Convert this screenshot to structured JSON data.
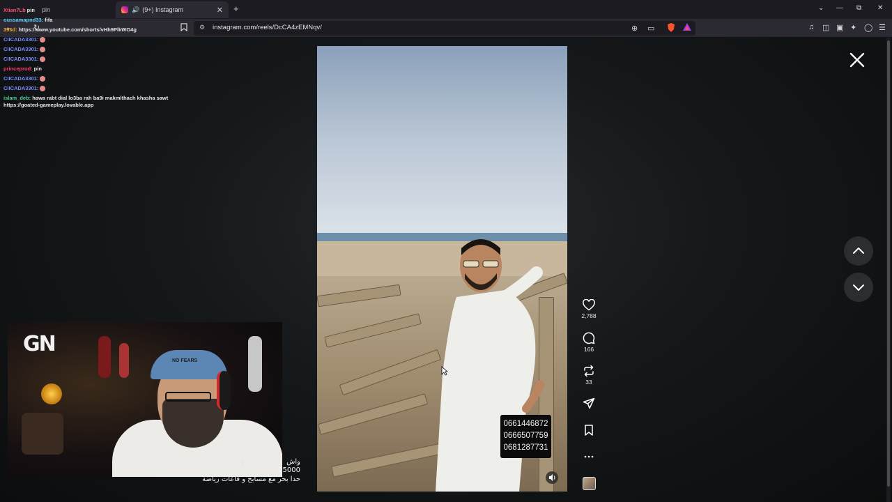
{
  "browser": {
    "tabs": [
      {
        "label": "pin",
        "active": false
      },
      {
        "label": "(9+) Instagram",
        "active": true
      }
    ],
    "url": "instagram.com/reels/DcCA4zEMNqv/",
    "icons": [
      "back-icon",
      "reload-icon",
      "bookmark-icon",
      "zoom-icon",
      "cast-icon",
      "brave-shield-icon",
      "rewards-icon",
      "music-icon",
      "sidebar-icon",
      "wallet-icon",
      "leo-ai-icon",
      "vpn-icon",
      "menu-icon"
    ]
  },
  "chat": {
    "messages": [
      {
        "user": "Xtian7Lb",
        "text": "pin",
        "color": "#ff4d6d"
      },
      {
        "user": "oussamapnd33:",
        "text": "fifa",
        "color": "#58d3ff"
      },
      {
        "user": "39sd:",
        "text": "https://www.youtube.com/shorts/vHh9PlkWO4g",
        "color": "#ffb02e"
      },
      {
        "user": "CIICADA3301:",
        "text": "",
        "color": "#7b8cff"
      },
      {
        "user": "CIICADA3301:",
        "text": "",
        "color": "#7b8cff"
      },
      {
        "user": "CIICADA3301:",
        "text": "",
        "color": "#7b8cff"
      },
      {
        "user": "princeprod:",
        "text": "pin",
        "color": "#ff3b6b"
      },
      {
        "user": "CIICADA3301:",
        "text": "",
        "color": "#7b8cff"
      },
      {
        "user": "CIICADA3301:",
        "text": "",
        "color": "#7b8cff"
      }
    ],
    "last_message": {
      "user": "islam_deb:",
      "text": "hawa rabt dial lo3ba rah ba9i makmlthach khasha sawt https://goated-gameplay.lovable.app",
      "color": "#4ed19a"
    }
  },
  "reel": {
    "likes": "2,788",
    "comments": "166",
    "reposts": "33",
    "phone_numbers": [
      "0661446872",
      "0666507759",
      "0681287731"
    ]
  },
  "webcam": {
    "logo": "GN",
    "cap_text": "NO FEARS"
  },
  "caption_lines": [
    "واش",
    "05000",
    "حدا بحر مع مسابح و قاعات رياضة"
  ]
}
